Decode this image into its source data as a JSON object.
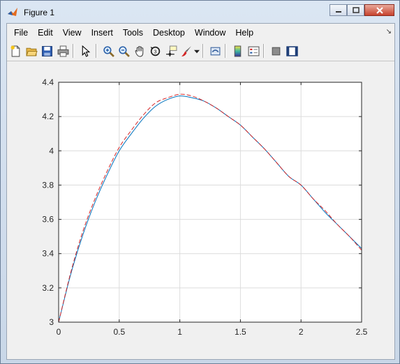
{
  "window": {
    "title": "Figure 1",
    "icon": "matlab-icon",
    "controls": [
      "minimize",
      "maximize",
      "close"
    ]
  },
  "menu": {
    "items": [
      "File",
      "Edit",
      "View",
      "Insert",
      "Tools",
      "Desktop",
      "Window",
      "Help"
    ],
    "dock_icon": "dock-arrow-icon"
  },
  "toolbar": {
    "buttons": [
      "new-figure-icon",
      "open-file-icon",
      "save-icon",
      "print-icon",
      "edit-plot-arrow-icon",
      "zoom-in-icon",
      "zoom-out-icon",
      "pan-hand-icon",
      "rotate-3d-icon",
      "data-cursor-icon",
      "brush-icon",
      "link-plot-icon",
      "colorbar-icon",
      "legend-icon",
      "hide-plot-tools-icon",
      "show-plot-tools-icon"
    ]
  },
  "chart_data": {
    "type": "line",
    "title": "",
    "xlabel": "",
    "ylabel": "",
    "xlim": [
      0,
      2.5
    ],
    "ylim": [
      3,
      4.4
    ],
    "xticks": [
      "0",
      "0.5",
      "1",
      "1.5",
      "2",
      "2.5"
    ],
    "yticks": [
      "3",
      "3.2",
      "3.4",
      "3.6",
      "3.8",
      "4",
      "4.2",
      "4.4"
    ],
    "grid": true,
    "legend": "none",
    "series": [
      {
        "style": "solid",
        "color": "#0072bd",
        "x": [
          0,
          0.1,
          0.2,
          0.3,
          0.4,
          0.5,
          0.6,
          0.7,
          0.8,
          0.9,
          1.0,
          1.1,
          1.2,
          1.3,
          1.4,
          1.5,
          1.6,
          1.7,
          1.8,
          1.9,
          2.0,
          2.1,
          2.2,
          2.3,
          2.4,
          2.5
        ],
        "y": [
          3.0,
          3.28,
          3.51,
          3.7,
          3.86,
          4.0,
          4.1,
          4.19,
          4.26,
          4.3,
          4.32,
          4.31,
          4.29,
          4.25,
          4.2,
          4.15,
          4.08,
          4.01,
          3.93,
          3.85,
          3.8,
          3.72,
          3.64,
          3.57,
          3.5,
          3.43
        ]
      },
      {
        "style": "dashed",
        "color": "#d62728",
        "x": [
          0,
          0.1,
          0.2,
          0.3,
          0.4,
          0.5,
          0.6,
          0.7,
          0.8,
          0.9,
          1.0,
          1.1,
          1.2,
          1.3,
          1.4,
          1.5,
          1.6,
          1.7,
          1.8,
          1.9,
          2.0,
          2.1,
          2.2,
          2.3,
          2.4,
          2.5
        ],
        "y": [
          3.0,
          3.29,
          3.53,
          3.72,
          3.88,
          4.02,
          4.12,
          4.21,
          4.28,
          4.31,
          4.33,
          4.32,
          4.29,
          4.25,
          4.2,
          4.15,
          4.08,
          4.01,
          3.93,
          3.85,
          3.8,
          3.72,
          3.65,
          3.57,
          3.5,
          3.42
        ]
      }
    ]
  }
}
